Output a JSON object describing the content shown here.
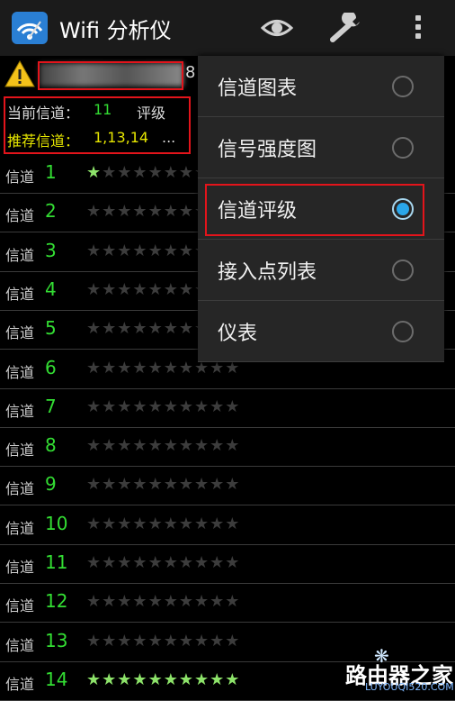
{
  "app": {
    "title": "Wifi 分析仪"
  },
  "status": {
    "ssid_tail": "8",
    "current_channel_label": "当前信道：",
    "current_channel_value": "11",
    "rating_label": "评级",
    "recommended_label": "推荐信道：",
    "recommended_value": "1,13,14",
    "recommended_more": "..."
  },
  "channels": [
    {
      "label": "信道",
      "number": "1",
      "rating": 1
    },
    {
      "label": "信道",
      "number": "2",
      "rating": 0
    },
    {
      "label": "信道",
      "number": "3",
      "rating": 0
    },
    {
      "label": "信道",
      "number": "4",
      "rating": 0
    },
    {
      "label": "信道",
      "number": "5",
      "rating": 0
    },
    {
      "label": "信道",
      "number": "6",
      "rating": 0
    },
    {
      "label": "信道",
      "number": "7",
      "rating": 0
    },
    {
      "label": "信道",
      "number": "8",
      "rating": 0
    },
    {
      "label": "信道",
      "number": "9",
      "rating": 0
    },
    {
      "label": "信道",
      "number": "10",
      "rating": 0
    },
    {
      "label": "信道",
      "number": "11",
      "rating": 0
    },
    {
      "label": "信道",
      "number": "12",
      "rating": 0
    },
    {
      "label": "信道",
      "number": "13",
      "rating": 0
    },
    {
      "label": "信道",
      "number": "14",
      "rating": 10
    }
  ],
  "menu": {
    "items": [
      {
        "label": "信道图表",
        "selected": false
      },
      {
        "label": "信号强度图",
        "selected": false
      },
      {
        "label": "信道评级",
        "selected": true
      },
      {
        "label": "接入点列表",
        "selected": false
      },
      {
        "label": "仪表",
        "selected": false
      }
    ]
  },
  "watermark": {
    "line1": "路由器之家",
    "line2": "LUYOUQI520.COM",
    "prefix": "Ba",
    "prefix_sub": "jing"
  },
  "colors": {
    "accent_green": "#33dd33",
    "recommend_yellow": "#e6e600",
    "highlight_red": "#e3141b",
    "radio_blue": "#2aa7ea"
  }
}
